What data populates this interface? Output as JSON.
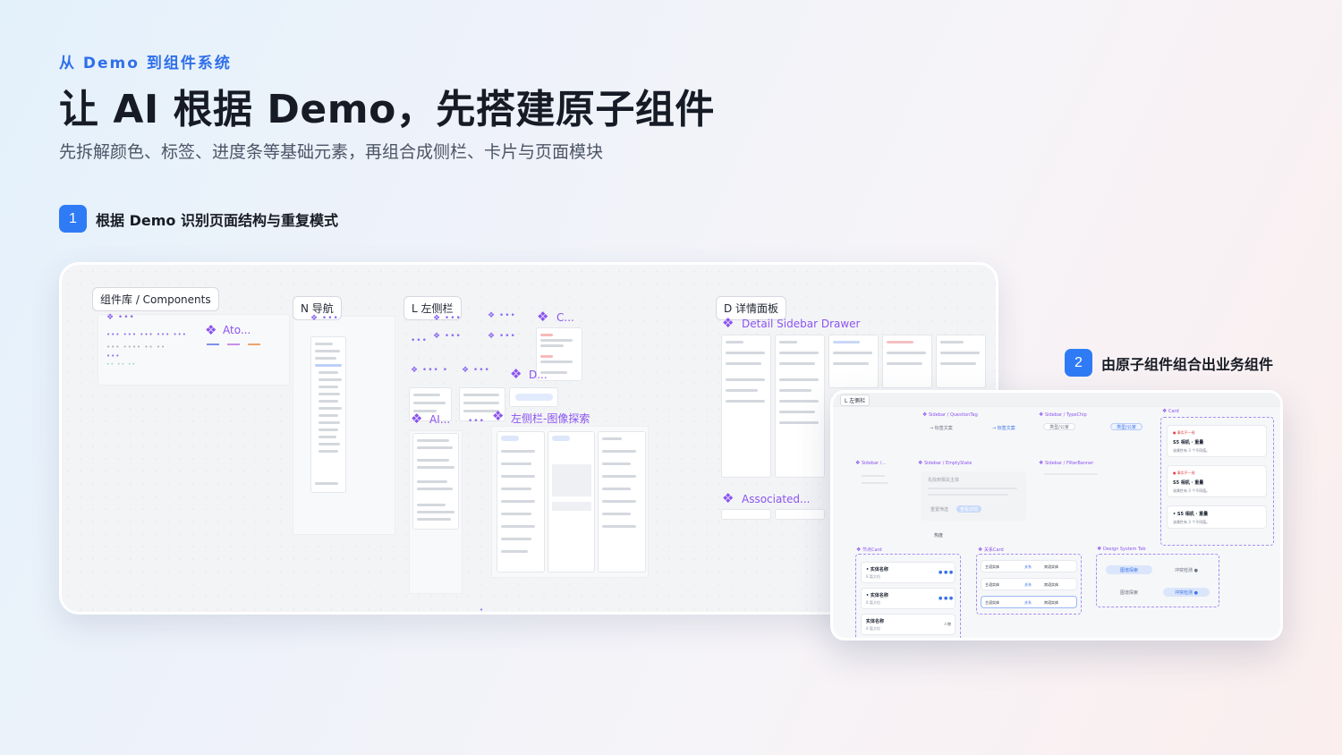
{
  "header": {
    "eyebrow": "从 Demo 到组件系统",
    "title": "让 AI 根据 Demo，先搭建原子组件",
    "subtitle": "先拆解颜色、标签、进度条等基础元素，再组合成侧栏、卡片与页面模块"
  },
  "steps": [
    {
      "num": "1",
      "label": "根据 Demo 识别页面结构与重复模式"
    },
    {
      "num": "2",
      "label": "由原子组件组合出业务组件"
    }
  ],
  "canvas": {
    "sections": {
      "components": "组件库 / Components",
      "nav": "N 导航",
      "left": "L 左侧栏",
      "detail": "D 详情面板"
    },
    "frames": {
      "ato": "Ato...",
      "c": "C...",
      "d": "D...",
      "ai": "AI...",
      "image_search": "左侧栏-图像探索",
      "detail_drawer": "Detail Sidebar Drawer",
      "associated": "Associated..."
    }
  },
  "composition": {
    "section_label": "L 左侧栏",
    "frames": {
      "question_tag": "Sidebar / QuestionTag",
      "type_chip": "Sidebar / TypeChip",
      "card": "Card",
      "sidebar_partial": "Sidebar /...",
      "empty_state": "Sidebar / EmptyState",
      "filter_banner": "Sidebar / FilterBanner",
      "node_card": "节点Card",
      "relation_card": "关系Card",
      "design_tab": "Design System Tab"
    },
    "question_tags": [
      "→ 标签文案",
      "→ 标签文案"
    ],
    "type_chips": [
      "类型/公家",
      "类型/公家"
    ],
    "card_items": [
      {
        "badge": "● 事实不一致",
        "title": "S5 相机 · 重量",
        "desc": "该属性有 3 个不同值。"
      },
      {
        "badge": "● 事实不一致",
        "title": "S5 相机 · 重量",
        "desc": "该属性有 3 个不同值。"
      },
      {
        "badge": "",
        "title": "• S5 相机 · 重量",
        "desc": "该属性有 3 个不同值。"
      }
    ],
    "empty": {
      "title": "先找到相关主体",
      "tag": "热度",
      "buttons": [
        "重置筛选",
        "查看详情"
      ]
    },
    "node_items": [
      {
        "title": "• 实体名称",
        "sub": "8 篇文档",
        "tag": "● ● ●"
      },
      {
        "title": "• 实体名称",
        "sub": "8 篇文档",
        "tag": "● ● ●"
      },
      {
        "title": "实体名称",
        "sub": "8 篇文档",
        "tag": "人物"
      }
    ],
    "relation_rows": [
      {
        "left": "主语实体",
        "mid": "关系",
        "right": "宾语实体"
      },
      {
        "left": "主语实体",
        "mid": "关系",
        "right": "宾语实体"
      },
      {
        "left": "主语实体",
        "mid": "关系",
        "right": "宾语实体"
      }
    ],
    "tabs": [
      {
        "a": "图谱探索",
        "b": "冲突检测 ●"
      },
      {
        "a": "图谱探索",
        "b": "冲突检测 ●"
      }
    ]
  },
  "colors": {
    "accent": "#2f7bf6",
    "component": "#8b54f0",
    "eyebrow": "#2f6fea"
  }
}
